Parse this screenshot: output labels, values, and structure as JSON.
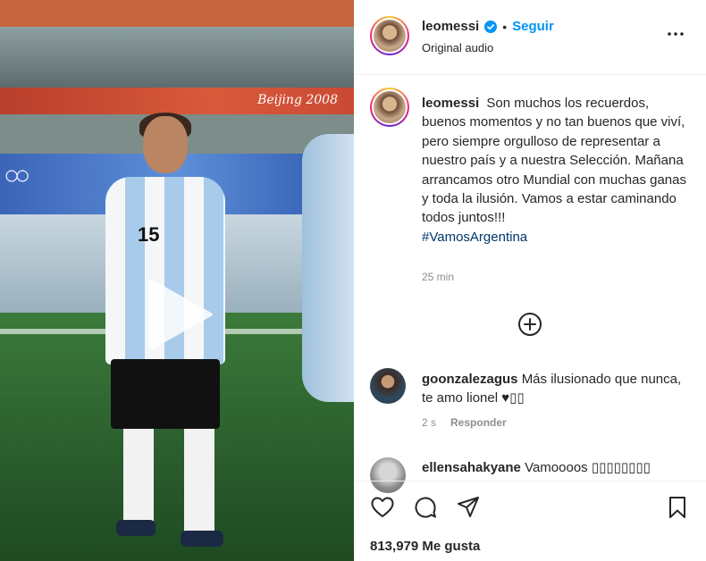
{
  "video": {
    "banner_text": "Beijing 2008",
    "shirt_number": "15",
    "play_icon": "play-icon"
  },
  "header": {
    "username": "leomessi",
    "verified_icon": "verified-badge-icon",
    "separator": "•",
    "follow_label": "Seguir",
    "audio": "Original audio",
    "more_icon": "more-options-icon"
  },
  "caption": {
    "username": "leomessi",
    "text": "Son muchos los recuerdos, buenos momentos y no tan buenos que viví, pero siempre orgulloso de representar a nuestro país y a nuestra Selección. Mañana arrancamos otro Mundial con muchas ganas y toda la ilusión. Vamos a estar caminando todos juntos!!!",
    "hashtag": "#VamosArgentina",
    "time": "25 min"
  },
  "add_comment_icon": "add-circle-icon",
  "comments": [
    {
      "username": "goonzalezagus",
      "text": "Más ilusionado que nunca, te amo lionel ♥▯▯",
      "time": "2 s",
      "reply_label": "Responder"
    },
    {
      "username": "ellensahakyane",
      "text": "Vamoooos ▯▯▯▯▯▯▯▯"
    }
  ],
  "actions": {
    "like_icon": "heart-icon",
    "comment_icon": "comment-icon",
    "share_icon": "send-icon",
    "save_icon": "bookmark-icon"
  },
  "likes": "813,979 Me gusta",
  "colors": {
    "link_blue": "#0095f6",
    "hashtag": "#00376b",
    "muted": "#8e8e8e"
  }
}
